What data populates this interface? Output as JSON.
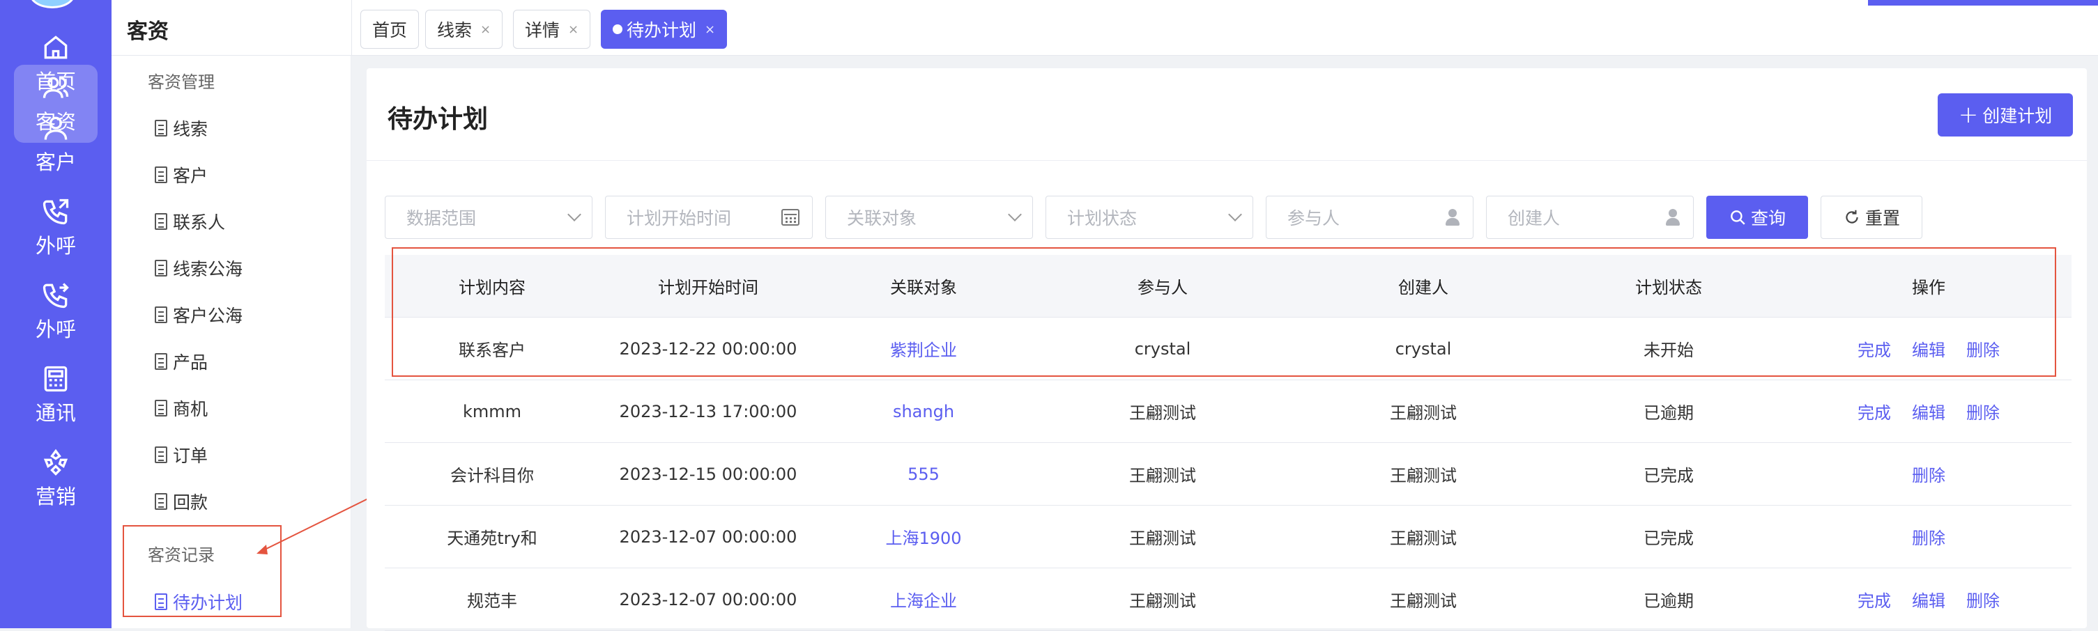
{
  "rail": {
    "items": [
      {
        "label": "首页",
        "icon": "home-icon"
      },
      {
        "label": "客资",
        "icon": "users-icon",
        "active": true
      },
      {
        "label": "客户",
        "icon": "user-icon"
      },
      {
        "label": "外呼",
        "icon": "phone-outgoing-icon"
      },
      {
        "label": "外呼",
        "icon": "phone-forward-icon"
      },
      {
        "label": "通讯",
        "icon": "address-book-icon"
      },
      {
        "label": "营销",
        "icon": "marketing-icon"
      }
    ]
  },
  "topbar": {
    "module_title": "客资",
    "tabs": [
      {
        "label": "首页",
        "closable": false
      },
      {
        "label": "线索",
        "closable": true
      },
      {
        "label": "详情",
        "closable": true
      },
      {
        "label": "待办计划",
        "closable": true,
        "active": true
      }
    ],
    "close_glyph": "×"
  },
  "subnav": {
    "group1_title": "客资管理",
    "group1_items": [
      "线索",
      "客户",
      "联系人",
      "线索公海",
      "客户公海",
      "产品",
      "商机",
      "订单",
      "回款"
    ],
    "group2_title": "客资记录",
    "group2_items": [
      "待办计划"
    ]
  },
  "main": {
    "title": "待办计划",
    "create_button": "创建计划",
    "filters": {
      "data_range": "数据范围",
      "start_time": "计划开始时间",
      "related_object": "关联对象",
      "plan_status": "计划状态",
      "participant": "参与人",
      "creator": "创建人"
    },
    "query_button": "查询",
    "reset_button": "重置",
    "table": {
      "columns": [
        "计划内容",
        "计划开始时间",
        "关联对象",
        "参与人",
        "创建人",
        "计划状态",
        "操作"
      ],
      "rows": [
        {
          "content": "联系客户",
          "start": "2023-12-22 00:00:00",
          "related": "紫荆企业",
          "participant": "crystal",
          "creator": "crystal",
          "status": "未开始",
          "actions": [
            "完成",
            "编辑",
            "删除"
          ]
        },
        {
          "content": "kmmm",
          "start": "2023-12-13 17:00:00",
          "related": "shangh",
          "participant": "王翩测试",
          "creator": "王翩测试",
          "status": "已逾期",
          "actions": [
            "完成",
            "编辑",
            "删除"
          ]
        },
        {
          "content": "会计科目你",
          "start": "2023-12-15 00:00:00",
          "related": "555",
          "participant": "王翩测试",
          "creator": "王翩测试",
          "status": "已完成",
          "actions": [
            "删除"
          ]
        },
        {
          "content": "天通苑try和",
          "start": "2023-12-07 00:00:00",
          "related": "上海1900",
          "participant": "王翩测试",
          "creator": "王翩测试",
          "status": "已完成",
          "actions": [
            "删除"
          ]
        },
        {
          "content": "规范丰",
          "start": "2023-12-07 00:00:00",
          "related": "上海企业",
          "participant": "王翩测试",
          "creator": "王翩测试",
          "status": "已逾期",
          "actions": [
            "完成",
            "编辑",
            "删除"
          ]
        }
      ]
    }
  },
  "colors": {
    "accent": "#5b5ef0",
    "annotation": "#e4543f"
  }
}
